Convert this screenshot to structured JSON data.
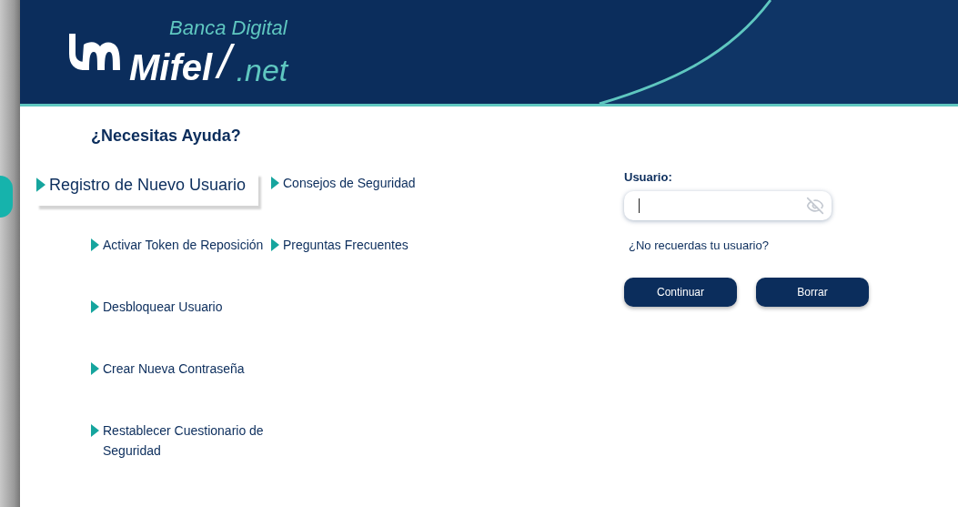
{
  "header": {
    "logo": {
      "tagline": "Banca Digital",
      "brand": "Mifel",
      "separator": "/",
      "suffix": ".net"
    }
  },
  "help": {
    "title": "¿Necesitas Ayuda?",
    "left_column": [
      {
        "label": "Registro de Nuevo Usuario",
        "selected": true
      },
      {
        "label": "Activar Token de Reposición",
        "selected": false
      },
      {
        "label": "Desbloquear Usuario",
        "selected": false
      },
      {
        "label": "Crear Nueva Contraseña",
        "selected": false
      },
      {
        "label": "Restablecer Cuestionario de Seguridad",
        "selected": false
      }
    ],
    "right_column": [
      {
        "label": "Consejos de Seguridad",
        "selected": false
      },
      {
        "label": "Preguntas Frecuentes",
        "selected": false
      }
    ]
  },
  "login": {
    "label": "Usuario:",
    "forgot_link": "¿No recuerdas tu usuario?",
    "buttons": [
      "Continuar",
      "Borrar"
    ]
  }
}
